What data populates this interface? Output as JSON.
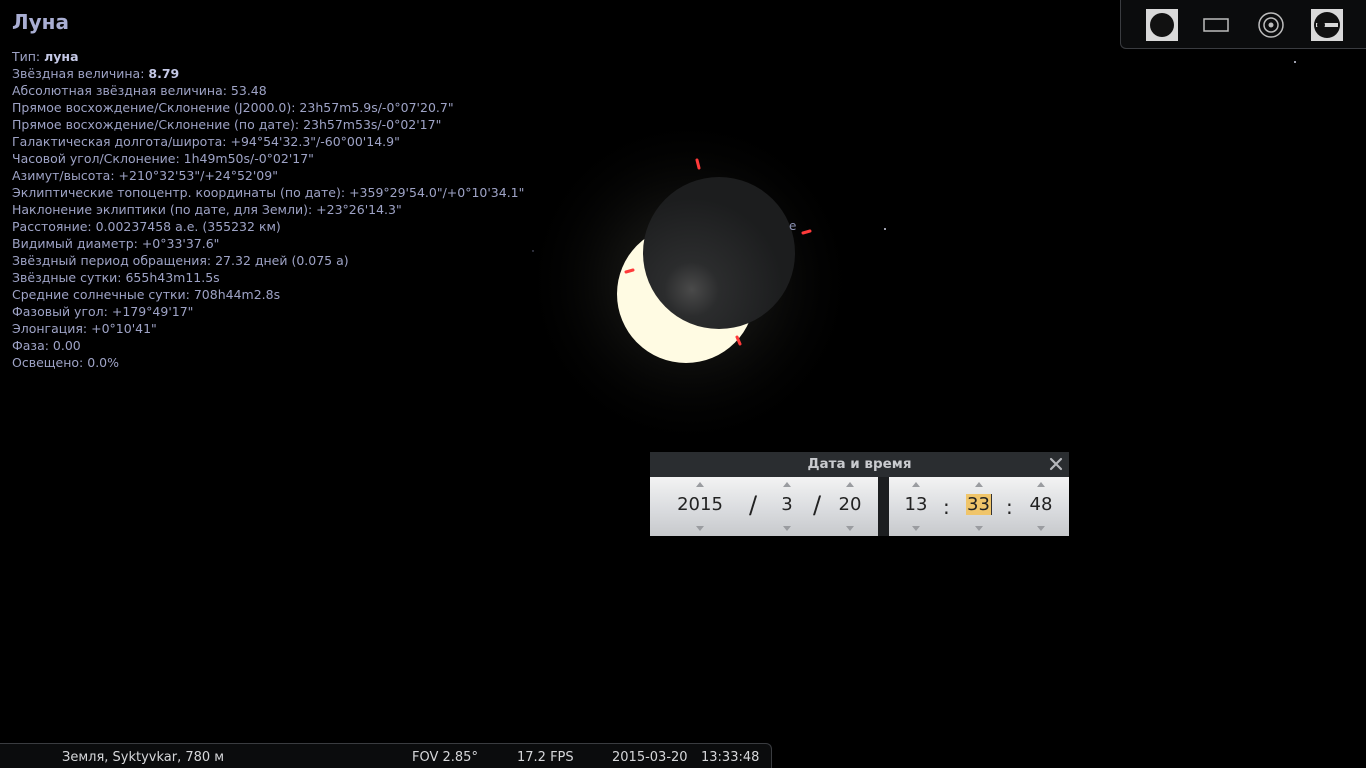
{
  "object": {
    "title": "Луна",
    "info": [
      {
        "label": "Тип: ",
        "value": "луна",
        "bold": true
      },
      {
        "label": "Звёздная величина: ",
        "value": "8.79",
        "bold": true
      },
      {
        "label": "Абсолютная звёздная величина: ",
        "value": "53.48"
      },
      {
        "label": "Прямое восхождение/Склонение (J2000.0): ",
        "value": "23h57m5.9s/-0°07'20.7\""
      },
      {
        "label": "Прямое восхождение/Склонение (по дате): ",
        "value": "23h57m53s/-0°02'17\""
      },
      {
        "label": "Галактическая долгота/широта: ",
        "value": "+94°54'32.3\"/-60°00'14.9\""
      },
      {
        "label": "Часовой угол/Склонение: ",
        "value": "1h49m50s/-0°02'17\""
      },
      {
        "label": "Азимут/высота: ",
        "value": "+210°32'53\"/+24°52'09\""
      },
      {
        "label": "Эклиптические топоцентр. координаты (по дате): ",
        "value": "+359°29'54.0\"/+0°10'34.1\""
      },
      {
        "label": "Наклонение эклиптики (по дате, для Земли): ",
        "value": "+23°26'14.3\""
      },
      {
        "label": "Расстояние: ",
        "value": "0.00237458 а.е. (355232 км)"
      },
      {
        "label": "Видимый диаметр: ",
        "value": "+0°33'37.6\""
      },
      {
        "label": "Звёздный период обращения: ",
        "value": "27.32 дней (0.075 a)"
      },
      {
        "label": "Звёздные сутки: ",
        "value": "655h43m11.5s"
      },
      {
        "label": "Средние солнечные сутки: ",
        "value": "708h44m2.8s"
      },
      {
        "label": "Фазовый угол: ",
        "value": "+179°49'17\""
      },
      {
        "label": "Элонгация: ",
        "value": "+0°10'41\""
      },
      {
        "label": "Фаза: ",
        "value": "0.00"
      },
      {
        "label": "Освещено: ",
        "value": "0.0%"
      }
    ]
  },
  "sky": {
    "label_e": "e",
    "sun_color": "#fffbe3",
    "moon_color": "#202122",
    "marker_color": "#ff3030"
  },
  "toolbar": {
    "buttons": [
      {
        "name": "circle-button-icon"
      },
      {
        "name": "rectangle-button-icon"
      },
      {
        "name": "target-button-icon"
      },
      {
        "name": "wrench-settings-icon"
      }
    ]
  },
  "datetime_dialog": {
    "title": "Дата и время",
    "year": "2015",
    "month": "3",
    "day": "20",
    "hour": "13",
    "minute": "33",
    "second": "48",
    "date_sep": "/",
    "time_sep": ":",
    "close_icon": "close-icon"
  },
  "statusbar": {
    "location": "Земля, Syktyvkar, 780 м",
    "fov": "FOV 2.85°",
    "fps": "17.2 FPS",
    "date": "2015-03-20",
    "time": "13:33:48"
  }
}
